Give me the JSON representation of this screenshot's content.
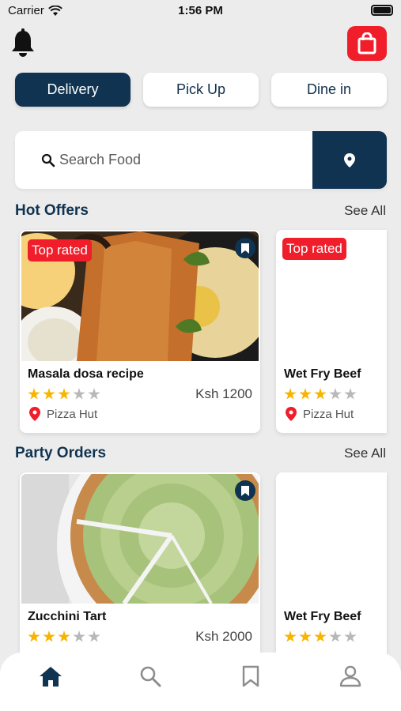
{
  "status": {
    "carrier": "Carrier",
    "time": "1:56 PM"
  },
  "modes": [
    "Delivery",
    "Pick Up",
    "Dine in"
  ],
  "search": {
    "placeholder": "Search Food"
  },
  "hot": {
    "title": "Hot Offers",
    "see_all": "See All",
    "cards": [
      {
        "badge": "Top rated",
        "name": "Masala dosa recipe",
        "price": "Ksh 1200",
        "place": "Pizza Hut",
        "rating": 3,
        "rating_max": 5
      },
      {
        "badge": "Top rated",
        "name": "Wet Fry Beef",
        "place": "Pizza Hut",
        "rating": 3,
        "rating_max": 5
      }
    ]
  },
  "party": {
    "title": "Party Orders",
    "see_all": "See All",
    "cards": [
      {
        "name": "Zucchini Tart",
        "price": "Ksh 2000",
        "rating": 3,
        "rating_max": 5
      },
      {
        "name": "Wet Fry Beef",
        "rating": 3,
        "rating_max": 5
      }
    ]
  },
  "colors": {
    "navy": "#0f3350",
    "red": "#f01d2a",
    "star": "#f7b500"
  },
  "icons": {
    "bell": "bell-icon",
    "cart": "shopping-bag-icon",
    "search": "search-icon",
    "location": "location-pin-icon",
    "bookmark": "bookmark-icon",
    "tabs": [
      "home-icon",
      "search-icon",
      "bookmark-icon",
      "profile-icon"
    ]
  },
  "tabs": {
    "active": 0
  }
}
